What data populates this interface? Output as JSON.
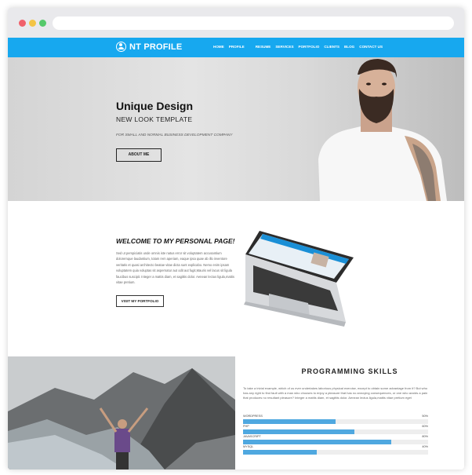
{
  "nav": {
    "brand": "NT PROFILE",
    "items": [
      "HOME",
      "PROFILE",
      "RESUME",
      "SERVICES",
      "PORTFOLIO",
      "CLIENTS",
      "BLOG",
      "CONTACT US"
    ]
  },
  "hero": {
    "title": "Unique Design",
    "subtitle": "NEW LOOK TEMPLATE",
    "tagline": "FOR SMALL AND NORMAL BUSINESS DEVELOPMENT COMPANY",
    "button": "ABOUT ME"
  },
  "welcome": {
    "title": "WELCOME TO MY PERSONAL PAGE!",
    "body": "Sed ut perspiciatis unde omnis iste natus error sit voluptatem accusantium doloremque laudantium, totam rem aperiam, eaque ipsa quae ab illo inventore veritatis et quasi architecto beatae vitae dicta sunt explicabo. Nemo enim ipsam voluptatem quia voluptas sit aspernatur aut odit aut fugit,Mauris vel lacus sit ligula faucibus suscipit. Integer a mattis diam, et sagittis dolor. Aenean lectus ligula,mattis vitae pretium.",
    "button": "VISIT MY PORTFOLIO"
  },
  "skills": {
    "title": "PROGRAMMING SKILLS",
    "description": "To take a trivial example, which of us ever undertakes laborious physical exercise, except to obtain some advantage from it? But who has any right to find fault with a man who chooses to enjoy a pleasure that has no annoying consequences, or one who avoids a pain that produces no resultant pleasure? Integer a mattis diam, et sagittis dolor. Aenean lectus ligula,mattis vitae pretium eget",
    "items": [
      {
        "name": "WORDPRESS",
        "percent_label": "50%",
        "level": 0.5
      },
      {
        "name": "PHP",
        "percent_label": "60%",
        "level": 0.6
      },
      {
        "name": "JAVASCRIPT",
        "percent_label": "80%",
        "level": 0.8
      },
      {
        "name": "MYSQL",
        "percent_label": "40%",
        "level": 0.4
      }
    ]
  },
  "colors": {
    "accent": "#17a8ef",
    "bar": "#4fa8e0"
  }
}
